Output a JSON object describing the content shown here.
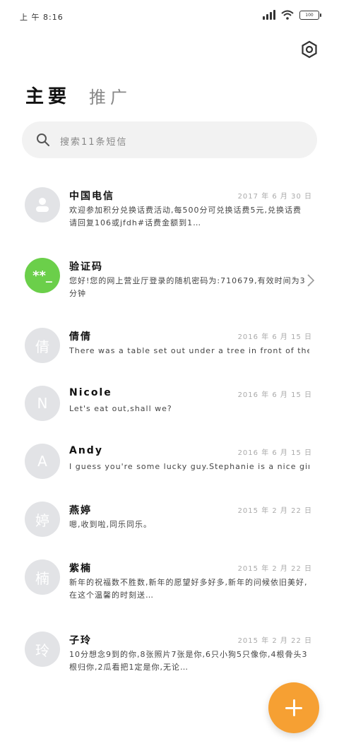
{
  "status_bar": {
    "time": "上 午 8:16",
    "battery": "100"
  },
  "tabs": [
    {
      "label": "主要"
    },
    {
      "label": "推广"
    }
  ],
  "search": {
    "placeholder": "搜索11条短信"
  },
  "conversations": [
    {
      "name": "中国电信",
      "date": "2017 年 6 月 30 日",
      "avatar": "",
      "avatar_icon": "person-icon",
      "preview": "欢迎参加积分兑换话费活动,每500分可兑换话费5元,兑换话费请回复106或jfdh#话费金额到1…"
    },
    {
      "name": "验证码",
      "date": "",
      "avatar": "**_",
      "avatar_icon": "code-icon",
      "preview": "您好!您的网上营业厅登录的随机密码为:710679,有效时间为3分钟"
    },
    {
      "name": "倩倩",
      "date": "2016 年 6 月 15 日",
      "avatar": "倩",
      "preview": "There was a table set out under a tree in front of the hous"
    },
    {
      "name": "Nicole",
      "date": "2016 年 6 月 15 日",
      "avatar": "N",
      "preview": "Let's eat out,shall we?"
    },
    {
      "name": "Andy",
      "date": "2016 年 6 月 15 日",
      "avatar": "A",
      "preview": "I guess you're some lucky guy.Stephanie is a nice girl."
    },
    {
      "name": "燕婷",
      "date": "2015 年 2 月 22 日",
      "avatar": "婷",
      "preview": "嗯,收到啦,同乐同乐。"
    },
    {
      "name": "紫楠",
      "date": "2015 年 2 月 22 日",
      "avatar": "楠",
      "preview": "新年的祝福数不胜数,新年的愿望好多好多,新年的问候依旧美好,在这个温馨的时刻送…"
    },
    {
      "name": "子玲",
      "date": "2015 年 2 月 22 日",
      "avatar": "玲",
      "preview": "10分想念9到的你,8张照片7张是你,6只小狗5只像你,4根骨头3根归你,2瓜看把1定是你,无论…"
    }
  ],
  "colors": {
    "fab": "#f6a033",
    "verify_avatar": "#6bcf4a",
    "avatar_default": "#e2e3e6"
  }
}
